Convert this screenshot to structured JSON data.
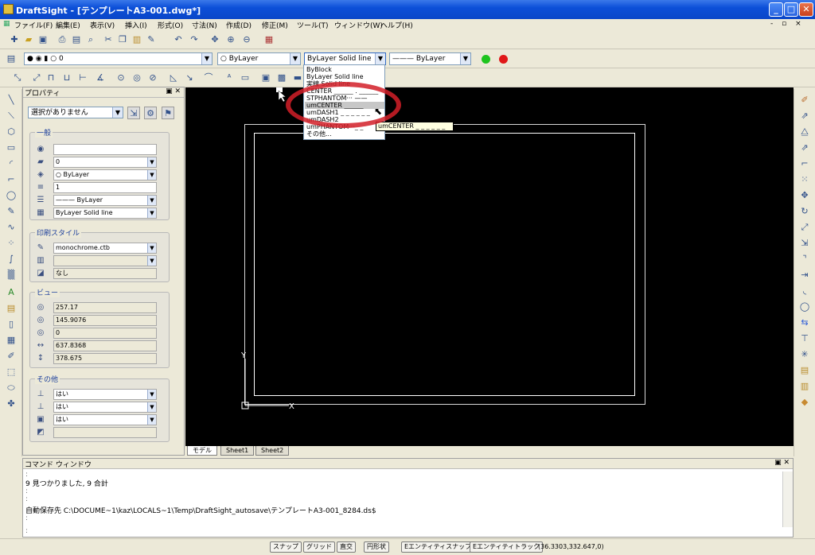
{
  "window": {
    "title": "DraftSight - [テンプレートA3-001.dwg*]",
    "minimize": "_",
    "maximize": "□",
    "close": "✕"
  },
  "menu": {
    "items": [
      "ファイル(F)",
      "編集(E)",
      "表示(V)",
      "挿入(I)",
      "形式(O)",
      "寸法(N)",
      "作成(D)",
      "修正(M)",
      "ツール(T)",
      "ウィンドウ(W)",
      "ヘルプ(H)"
    ],
    "doc_controls": "- ▫ ×"
  },
  "toolbar": {
    "layer_combo": "0",
    "color_combo": "ByLayer",
    "linestyle_combo": "ByLayer   Solid line",
    "lineweight_combo": "——— ByLayer"
  },
  "linestyle_dropdown": {
    "items": [
      "ByBlock",
      "ByLayer      Solid line",
      "実線        Solid line",
      "CENTER ______ . ______",
      "STPHANTOM···  ——",
      "umCENTER ______",
      "umDASH1 _ _ _ _ _ _",
      "umDASH2",
      "umPHANTOM···_ _",
      "その他..."
    ],
    "highlighted_index": 5,
    "tooltip": "umCENTER _ _ _ _ _ _"
  },
  "properties": {
    "title": "プロパティ",
    "panel_controls": "▣ ✕",
    "selection_combo": "選択がありません",
    "groups": {
      "general": {
        "title": "一般",
        "fields": [
          "",
          "0",
          "ByLayer",
          "1",
          "——— ByLayer",
          "ByLayer      Solid line"
        ]
      },
      "print_style": {
        "title": "印刷スタイル",
        "fields": [
          "monochrome.ctb",
          "",
          "なし"
        ]
      },
      "view": {
        "title": "ビュー",
        "fields": [
          "257.17",
          "145.9076",
          "0",
          "637.8368",
          "378.675"
        ]
      },
      "other": {
        "title": "その他",
        "fields": [
          "はい",
          "はい",
          "はい",
          ""
        ]
      }
    }
  },
  "canvas": {
    "ucs_y": "Y",
    "ucs_x": "X"
  },
  "tabs": [
    "モデル",
    "Sheet1",
    "Sheet2"
  ],
  "command_window": {
    "title": "コマンド ウィンドウ",
    "controls": "▣ ✕",
    "lines": [
      ":",
      "9 見つかりました, 9 合計",
      ":",
      ":",
      "自動保存先 C:\\DOCUME~1\\kaz\\LOCALS~1\\Temp\\DraftSight_autosave\\テンプレートA3-001_8284.ds$",
      ":",
      ":"
    ]
  },
  "statusbar": {
    "buttons": [
      "スナップ",
      "グリッド",
      "直交",
      "円形状",
      "Eエンティティスナップ",
      "Eエンティティトラック"
    ],
    "coords": "(36.3303,332.647,0)"
  },
  "colors": {
    "canvas_bg": "#000000",
    "highlight": "#d21e28",
    "title_blue": "#0c4fd8"
  }
}
